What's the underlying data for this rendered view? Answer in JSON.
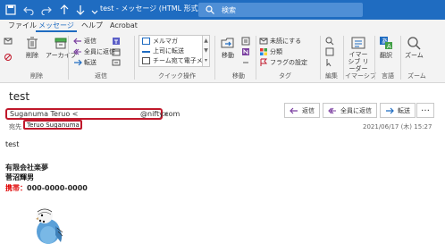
{
  "window": {
    "title": "test - メッセージ (HTML 形式)",
    "search_placeholder": "検索"
  },
  "tabs": [
    {
      "label": "ファイル"
    },
    {
      "label": "メッセージ"
    },
    {
      "label": "ヘルプ"
    },
    {
      "label": "Acrobat"
    }
  ],
  "ribbon": {
    "delete_group": {
      "delete": "削除",
      "archive": "アーカイブ",
      "label": "削除"
    },
    "respond_group": {
      "reply": "返信",
      "reply_all": "全員に返信",
      "forward": "転送",
      "label": "返信"
    },
    "quick_steps": {
      "items": [
        "メルマガ",
        "上司に転送",
        "チーム宛て電子メ"
      ],
      "label": "クイック操作"
    },
    "move_group": {
      "move": "移動",
      "label": "移動"
    },
    "tags_group": {
      "unread": "未読にする",
      "categorize": "分類",
      "follow_up": "フラグの設定",
      "label": "タグ"
    },
    "edit_group": {
      "label": "編集"
    },
    "immersive_group": {
      "reader": "イマーシブ リーダー",
      "label": "イマーシブ"
    },
    "language_group": {
      "translate": "翻訳",
      "label": "言語"
    },
    "zoom_group": {
      "zoom": "ズーム",
      "label": "ズーム"
    }
  },
  "message": {
    "subject": "test",
    "sender_name": "Suganuma Teruo <",
    "sender_email": "@nifty.com",
    "sender_close": ">",
    "to_label": "宛先",
    "recipient": "Teruo Suganuma",
    "reply": "返信",
    "reply_all": "全員に返信",
    "forward": "転送",
    "more": "…",
    "date": "2021/06/17 (木) 15:27",
    "body": "test"
  },
  "signature": {
    "company": "有限会社楽夢",
    "name": "菅沼輝男",
    "phone_label": "携帯：",
    "phone_number": "000-0000-0000"
  },
  "colors": {
    "titlebar": "#1f6cc1",
    "highlight_border": "#c0182b",
    "signature_red": "#e00000"
  }
}
